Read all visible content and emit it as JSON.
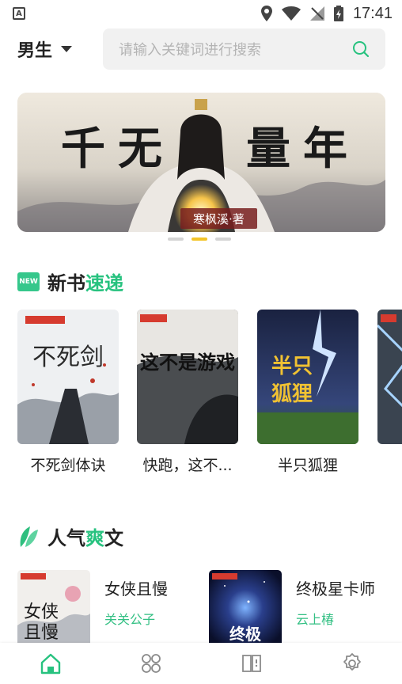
{
  "status_bar": {
    "time": "17:41"
  },
  "top_bar": {
    "gender_label": "男生",
    "search_placeholder": "请输入关键词进行搜索"
  },
  "banner": {
    "title_chars": [
      "千",
      "无",
      "量",
      "年"
    ],
    "author": "寒枫溪·著",
    "active_dot": 1
  },
  "new_books": {
    "heading_prefix": "新书",
    "heading_accent": "速递",
    "badge": "NEW",
    "books": [
      {
        "title": "不死剑体诀",
        "cover_text": "不死剑"
      },
      {
        "title": "快跑，这不...",
        "cover_text": "这不是游戏"
      },
      {
        "title": "半只狐狸",
        "cover_text": "半只狐狸"
      }
    ]
  },
  "hot_books": {
    "heading_prefix": "人气",
    "heading_accent": "爽",
    "heading_suffix": "文",
    "items": [
      {
        "title": "女侠且慢",
        "author": "关关公子",
        "cover_text": "女侠且慢"
      },
      {
        "title": "终极星卡师",
        "author": "云上椿",
        "cover_text": "终极"
      }
    ]
  },
  "tabs": [
    {
      "name": "home",
      "active": true
    },
    {
      "name": "category",
      "active": false
    },
    {
      "name": "bookshelf",
      "active": false
    },
    {
      "name": "settings",
      "active": false
    }
  ],
  "colors": {
    "accent": "#27c27f",
    "dot_active": "#f3c428"
  }
}
